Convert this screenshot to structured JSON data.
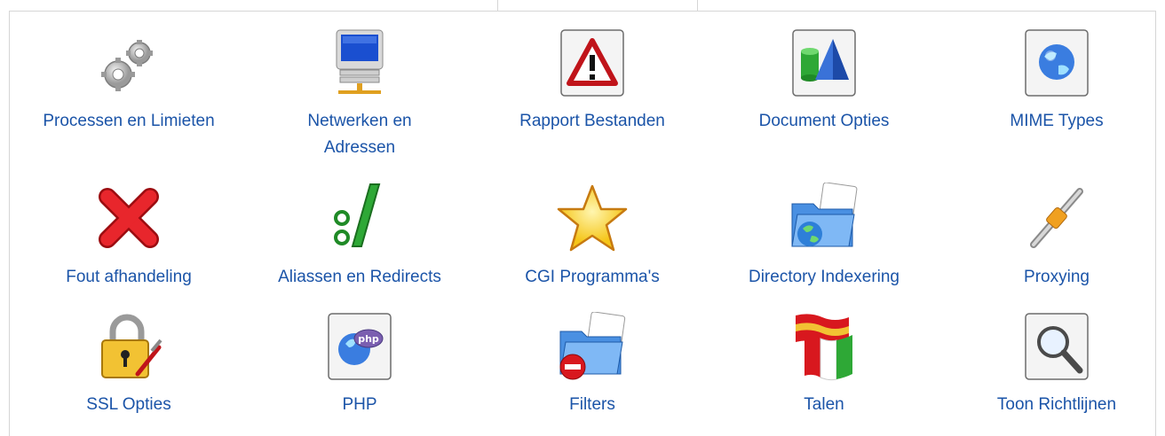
{
  "items": [
    {
      "label": "Processen en Limieten",
      "icon": "gears-icon"
    },
    {
      "label": "Netwerken en\nAdressen",
      "icon": "network-computer-icon"
    },
    {
      "label": "Rapport Bestanden",
      "icon": "warning-icon"
    },
    {
      "label": "Document Opties",
      "icon": "shapes-icon"
    },
    {
      "label": "MIME Types",
      "icon": "globe-icon"
    },
    {
      "label": "Fout afhandeling",
      "icon": "red-x-icon"
    },
    {
      "label": "Aliassen en Redirects",
      "icon": "colon-slash-icon"
    },
    {
      "label": "CGI Programma's",
      "icon": "star-icon"
    },
    {
      "label": "Directory Indexering",
      "icon": "folder-globe-icon"
    },
    {
      "label": "Proxying",
      "icon": "cable-icon"
    },
    {
      "label": "SSL Opties",
      "icon": "padlock-icon"
    },
    {
      "label": "PHP",
      "icon": "php-icon"
    },
    {
      "label": "Filters",
      "icon": "folder-remove-icon"
    },
    {
      "label": "Talen",
      "icon": "flags-icon"
    },
    {
      "label": "Toon Richtlijnen",
      "icon": "magnifier-icon"
    }
  ],
  "colors": {
    "link": "#1b54a8",
    "border": "#d6d6d6"
  }
}
